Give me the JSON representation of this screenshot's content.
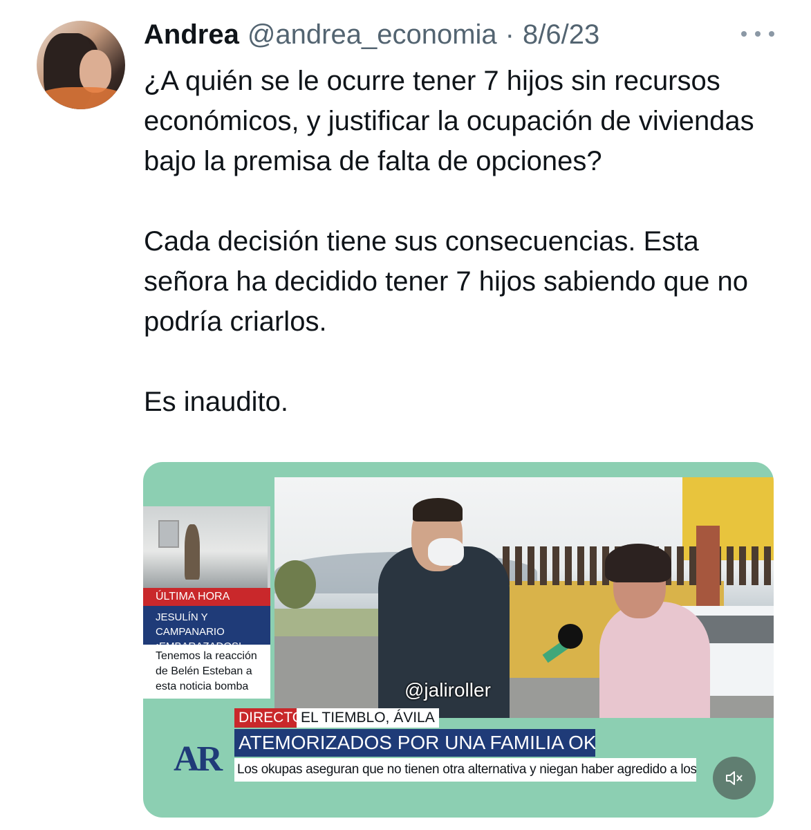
{
  "tweet": {
    "author_name": "Andrea",
    "handle": "@andrea_economia",
    "separator": "·",
    "date": "8/6/23",
    "paragraphs": [
      "¿A quién se le ocurre tener 7 hijos sin recursos económicos, y justificar la ocupación de viviendas bajo la premisa de falta de opciones?",
      "Cada decisión tiene sus consecuencias. Esta señora ha decidido tener 7 hijos sabiendo que no podría criarlos.",
      "Es inaudito."
    ]
  },
  "media": {
    "side_panel": {
      "ultima_hora": "ÚLTIMA HORA",
      "headline": "JESULÍN Y CAMPANARIO ¡EMBARAZADOS!",
      "teaser": "Tenemos la reacción de Belén Esteban a esta noticia bomba"
    },
    "watermark": "@jaliroller",
    "lower_third": {
      "live_label": "DIRECTO",
      "location": "EL TIEMBLO, ÁVILA",
      "headline": "ATEMORIZADOS POR UNA FAMILIA OKUPA",
      "subtitle": "Los okupas aseguran que no tienen otra alternativa y niegan haber agredido a los vecinos"
    },
    "logo": "AR",
    "icons": {
      "captions": "closed-captions-off-icon",
      "mute": "volume-muted-icon",
      "more": "more-horizontal-icon"
    }
  },
  "colors": {
    "text_primary": "#0f1419",
    "text_secondary": "#536471",
    "media_frame": "#8ccfb2",
    "news_blue": "#1f3b78",
    "news_red": "#c9282b"
  }
}
